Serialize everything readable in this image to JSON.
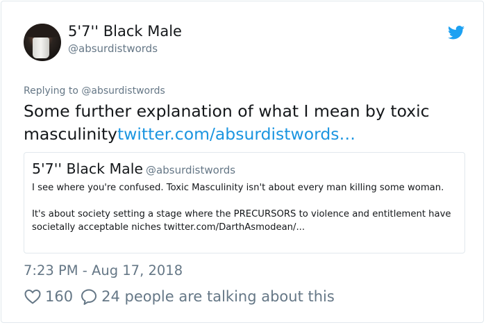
{
  "author": {
    "name": "5'7'' Black Male",
    "handle": "@absurdistwords"
  },
  "reply_context": "Replying to @absurdistwords",
  "tweet": {
    "text": "Some further explanation of what I mean by toxic masculinity",
    "link": "twitter.com/absurdistwords…"
  },
  "quoted_tweet": {
    "name": "5'7'' Black Male",
    "handle": "@absurdistwords",
    "paragraph_1": "I see where you're confused. Toxic Masculinity isn't about every man killing some woman.",
    "paragraph_2": "It's about society setting a stage where the PRECURSORS to violence and entitlement have societally acceptable niches twitter.com/DarthAsmodean/..."
  },
  "timestamp": "7:23 PM - Aug 17, 2018",
  "engagement": {
    "likes": "160",
    "talking_text": "24 people are talking about this"
  },
  "icons": {
    "brand": "twitter-bird-icon",
    "like": "heart-icon",
    "reply": "speech-bubble-icon"
  },
  "colors": {
    "link": "#1b95e0",
    "brand": "#1da1f2",
    "secondary_text": "#657786",
    "border": "#e1e8ed"
  }
}
